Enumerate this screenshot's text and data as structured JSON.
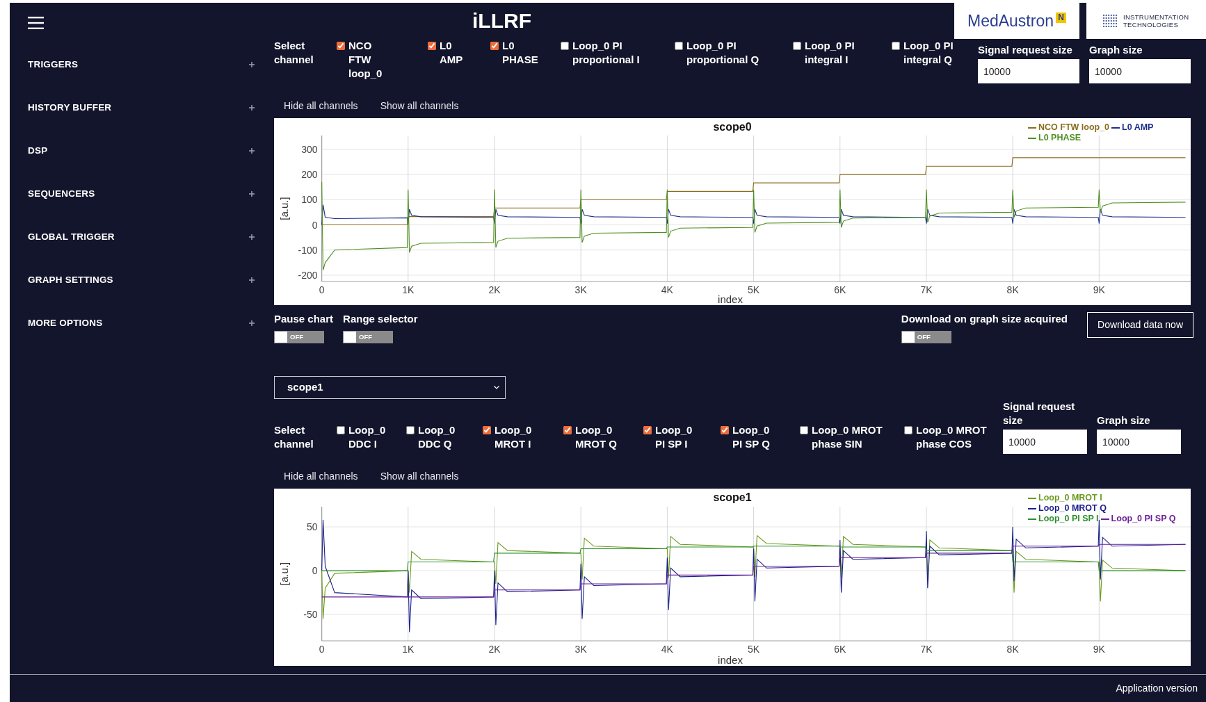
{
  "header": {
    "title": "iLLRF",
    "logos": {
      "medaustron": {
        "text": "MedAustron",
        "mark": "N"
      },
      "instrumentation": {
        "text": "INSTRUMENTATION TECHNOLOGIES"
      }
    }
  },
  "sidebar": {
    "items": [
      {
        "label": "TRIGGERS",
        "expanded": false
      },
      {
        "label": "HISTORY BUFFER",
        "expanded": false
      },
      {
        "label": "DSP",
        "expanded": false
      },
      {
        "label": "SEQUENCERS",
        "expanded": false
      },
      {
        "label": "GLOBAL TRIGGER",
        "expanded": false
      },
      {
        "label": "GRAPH SETTINGS",
        "expanded": false
      },
      {
        "label": "MORE OPTIONS",
        "expanded": false
      }
    ]
  },
  "scopes": [
    {
      "select_label": "Select channel",
      "channels": [
        {
          "label": "NCO FTW loop_0",
          "checked": true
        },
        {
          "label": "L0 AMP",
          "checked": true
        },
        {
          "label": "L0 PHASE",
          "checked": true
        },
        {
          "label": "Loop_0 PI proportional I",
          "checked": false
        },
        {
          "label": "Loop_0 PI proportional Q",
          "checked": false
        },
        {
          "label": "Loop_0 PI integral I",
          "checked": false
        },
        {
          "label": "Loop_0 PI integral Q",
          "checked": false
        }
      ],
      "signal_request_size": {
        "label": "Signal request size",
        "value": "10000"
      },
      "graph_size": {
        "label": "Graph size",
        "value": "10000"
      },
      "links": [
        "Hide all channels",
        "Show all channels"
      ],
      "chart_data": {
        "type": "line",
        "title": "scope0",
        "xlabel": "index",
        "ylabel": "[a.u.]",
        "xlim": [
          0,
          10060
        ],
        "ylim": [
          -225,
          355
        ],
        "grid": true,
        "legend": true,
        "xticks": [
          {
            "value": 0,
            "label": "0"
          },
          {
            "value": 1000,
            "label": "1K"
          },
          {
            "value": 2000,
            "label": "2K"
          },
          {
            "value": 3000,
            "label": "3K"
          },
          {
            "value": 4000,
            "label": "4K"
          },
          {
            "value": 5000,
            "label": "5K"
          },
          {
            "value": 6000,
            "label": "6K"
          },
          {
            "value": 7000,
            "label": "7K"
          },
          {
            "value": 8000,
            "label": "8K"
          },
          {
            "value": 9000,
            "label": "9K"
          }
        ],
        "yticks": [
          -200,
          -100,
          0,
          100,
          200,
          300
        ],
        "x": [
          0,
          15,
          40,
          150,
          990,
          1000,
          1015,
          1040,
          1150,
          1990,
          2000,
          2015,
          2040,
          2150,
          2990,
          3000,
          3015,
          3040,
          3150,
          3990,
          4000,
          4015,
          4040,
          4150,
          4990,
          5000,
          5015,
          5040,
          5150,
          5990,
          6000,
          6015,
          6040,
          6150,
          6990,
          7000,
          7015,
          7040,
          7150,
          7990,
          8000,
          8015,
          8040,
          8150,
          8990,
          9000,
          9015,
          9040,
          9150,
          9990,
          10000
        ],
        "series": [
          {
            "name": "NCO FTW loop_0",
            "color": "#8a6d1e",
            "values": [
              0,
              0,
              0,
              0,
              0,
              33,
              33,
              33,
              33,
              33,
              67,
              67,
              67,
              67,
              67,
              100,
              100,
              100,
              100,
              100,
              133,
              133,
              133,
              133,
              133,
              167,
              167,
              167,
              167,
              167,
              200,
              200,
              200,
              200,
              200,
              233,
              233,
              233,
              233,
              233,
              267,
              267,
              267,
              267,
              267,
              267,
              267,
              267,
              267,
              267,
              267
            ]
          },
          {
            "name": "L0 AMP",
            "color": "#1e2f8c",
            "values": [
              0,
              80,
              30,
              25,
              28,
              5,
              62,
              38,
              32,
              30,
              5,
              62,
              38,
              32,
              30,
              5,
              62,
              38,
              32,
              30,
              5,
              62,
              38,
              32,
              30,
              5,
              62,
              38,
              32,
              30,
              5,
              62,
              38,
              32,
              30,
              5,
              62,
              38,
              32,
              30,
              5,
              62,
              38,
              32,
              30,
              5,
              62,
              38,
              32,
              30,
              30
            ]
          },
          {
            "name": "L0 PHASE",
            "color": "#4f8f1f",
            "values": [
              170,
              -180,
              -150,
              -100,
              -90,
              140,
              -110,
              -85,
              -73,
              -70,
              140,
              -90,
              -65,
              -53,
              -50,
              140,
              -70,
              -45,
              -33,
              -30,
              140,
              -50,
              -25,
              -13,
              -10,
              140,
              -30,
              -5,
              7,
              10,
              140,
              -10,
              15,
              27,
              30,
              140,
              10,
              35,
              47,
              50,
              140,
              30,
              55,
              67,
              70,
              140,
              50,
              75,
              87,
              90,
              90
            ]
          }
        ]
      },
      "controls": {
        "toggles": [
          {
            "label": "Pause chart",
            "on": false,
            "state_text": "OFF"
          },
          {
            "label": "Range selector",
            "on": false,
            "state_text": "OFF"
          }
        ],
        "download_toggle": {
          "label": "Download on graph size acquired",
          "on": false,
          "state_text": "OFF"
        },
        "download_button": "Download data now"
      }
    },
    {
      "selector": {
        "value": "scope1"
      },
      "select_label": "Select channel",
      "channels": [
        {
          "label": "Loop_0 DDC I",
          "checked": false
        },
        {
          "label": "Loop_0 DDC Q",
          "checked": false
        },
        {
          "label": "Loop_0 MROT I",
          "checked": true
        },
        {
          "label": "Loop_0 MROT Q",
          "checked": true
        },
        {
          "label": "Loop_0 PI SP I",
          "checked": true
        },
        {
          "label": "Loop_0 PI SP Q",
          "checked": true
        },
        {
          "label": "Loop_0 MROT phase SIN",
          "checked": false
        },
        {
          "label": "Loop_0 MROT phase COS",
          "checked": false
        }
      ],
      "signal_request_size": {
        "label": "Signal request size",
        "value": "10000"
      },
      "graph_size": {
        "label": "Graph size",
        "value": "10000"
      },
      "links": [
        "Hide all channels",
        "Show all channels"
      ],
      "chart_data": {
        "type": "line",
        "title": "scope1",
        "xlabel": "index",
        "ylabel": "[a.u.]",
        "xlim": [
          0,
          10060
        ],
        "ylim": [
          -80,
          73
        ],
        "grid": true,
        "legend": true,
        "xticks": [
          {
            "value": 0,
            "label": "0"
          },
          {
            "value": 1000,
            "label": "1K"
          },
          {
            "value": 2000,
            "label": "2K"
          },
          {
            "value": 3000,
            "label": "3K"
          },
          {
            "value": 4000,
            "label": "4K"
          },
          {
            "value": 5000,
            "label": "5K"
          },
          {
            "value": 6000,
            "label": "6K"
          },
          {
            "value": 7000,
            "label": "7K"
          },
          {
            "value": 8000,
            "label": "8K"
          },
          {
            "value": 9000,
            "label": "9K"
          }
        ],
        "yticks": [
          -50,
          0,
          50
        ],
        "x": [
          0,
          15,
          40,
          150,
          990,
          1000,
          1015,
          1040,
          1150,
          1990,
          2000,
          2015,
          2040,
          2150,
          2990,
          3000,
          3015,
          3040,
          3150,
          3990,
          4000,
          4015,
          4040,
          4150,
          4990,
          5000,
          5015,
          5040,
          5150,
          5990,
          6000,
          6015,
          6040,
          6150,
          6990,
          7000,
          7015,
          7040,
          7150,
          7990,
          8000,
          8015,
          8040,
          8150,
          8990,
          9000,
          9015,
          9040,
          9150,
          9990,
          10000
        ],
        "series": [
          {
            "name": "Loop_0 MROT I",
            "color": "#6b9a1e",
            "values": [
              0,
              -55,
              -20,
              -3,
              0,
              0,
              -25,
              22,
              13,
              10,
              10,
              -15,
              32,
              23,
              20,
              20,
              -10,
              37,
              28,
              25,
              25,
              -8,
              39,
              30,
              27,
              27,
              -7,
              40,
              31,
              28,
              28,
              -8,
              39,
              30,
              27,
              27,
              -12,
              35,
              26,
              23,
              23,
              -25,
              22,
              13,
              10,
              10,
              -35,
              12,
              3,
              0,
              0
            ]
          },
          {
            "name": "Loop_0 MROT Q",
            "color": "#1a1f8a",
            "values": [
              0,
              58,
              5,
              -25,
              -30,
              0,
              -70,
              -22,
              -32,
              -30,
              0,
              -62,
              -14,
              -24,
              -22,
              8,
              -55,
              -7,
              -17,
              -15,
              15,
              -45,
              3,
              -7,
              -5,
              25,
              -35,
              13,
              3,
              5,
              35,
              -25,
              23,
              13,
              15,
              45,
              -20,
              28,
              18,
              20,
              50,
              -12,
              36,
              26,
              28,
              58,
              -10,
              38,
              28,
              30,
              30
            ]
          },
          {
            "name": "Loop_0 PI SP I",
            "color": "#2b8f2b",
            "values": [
              0,
              0,
              0,
              0,
              0,
              10,
              10,
              10,
              10,
              10,
              20,
              20,
              20,
              20,
              20,
              25,
              25,
              25,
              25,
              25,
              27,
              27,
              27,
              27,
              27,
              28,
              28,
              28,
              28,
              28,
              27,
              27,
              27,
              27,
              27,
              23,
              23,
              23,
              23,
              23,
              10,
              10,
              10,
              10,
              10,
              0,
              0,
              0,
              0,
              0,
              0
            ]
          },
          {
            "name": "Loop_0 PI SP Q",
            "color": "#6a1f9a",
            "values": [
              -30,
              -30,
              -30,
              -30,
              -30,
              -30,
              -30,
              -30,
              -30,
              -30,
              -22,
              -22,
              -22,
              -22,
              -22,
              -15,
              -15,
              -15,
              -15,
              -15,
              -5,
              -5,
              -5,
              -5,
              -5,
              5,
              5,
              5,
              5,
              5,
              15,
              15,
              15,
              15,
              15,
              20,
              20,
              20,
              20,
              20,
              28,
              28,
              28,
              28,
              28,
              30,
              30,
              30,
              30,
              30,
              30
            ]
          }
        ]
      }
    }
  ],
  "footer": {
    "text": "Application version"
  }
}
